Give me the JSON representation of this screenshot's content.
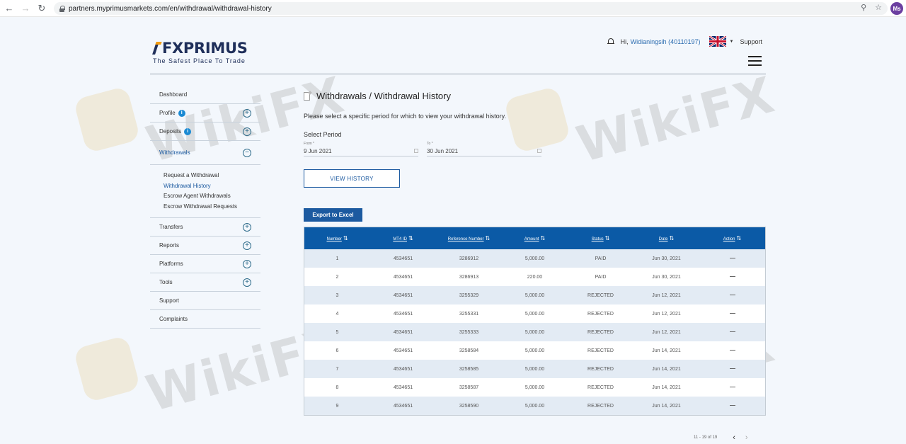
{
  "browser": {
    "back_icon": "arrow-left-icon",
    "forward_icon": "arrow-right-icon",
    "reload_icon": "reload-icon",
    "url": "partners.myprimusmarkets.com/en/withdrawal/withdrawal-history",
    "profile_initials": "Ms"
  },
  "header": {
    "logo_text": "FXPRIMUS",
    "tagline": "The Safest Place To Trade",
    "greeting": "Hi,",
    "user": "Widianingsih (40110197)",
    "support": "Support"
  },
  "sidebar": {
    "items": [
      {
        "label": "Dashboard"
      },
      {
        "label": "Profile"
      },
      {
        "label": "Deposits"
      },
      {
        "label": "Withdrawals"
      },
      {
        "label": "Transfers"
      },
      {
        "label": "Reports"
      },
      {
        "label": "Platforms"
      },
      {
        "label": "Tools"
      },
      {
        "label": "Support"
      },
      {
        "label": "Complaints"
      }
    ],
    "withdrawal_sub": [
      "Request a Withdrawal",
      "Withdrawal History",
      "Escrow Agent Withdrawals",
      "Escrow Withdrawal Requests"
    ]
  },
  "main": {
    "title": "Withdrawals / Withdrawal History",
    "intro": "Please select a specific period for which to view your withdrawal history.",
    "select_period": "Select Period",
    "from_label": "From *",
    "from_value": "9 Jun 2021",
    "to_label": "To *",
    "to_value": "30 Jun 2021",
    "view_history": "VIEW HISTORY",
    "export": "Export to Excel"
  },
  "table": {
    "columns": [
      "Number",
      "MT4 ID",
      "Reference Number",
      "Amount",
      "Status",
      "Date",
      "Action"
    ],
    "rows": [
      [
        "1",
        "4534651",
        "3286912",
        "5,000.00",
        "PAID",
        "Jun 30, 2021"
      ],
      [
        "2",
        "4534651",
        "3286913",
        "220.00",
        "PAID",
        "Jun 30, 2021"
      ],
      [
        "3",
        "4534651",
        "3255329",
        "5,000.00",
        "REJECTED",
        "Jun 12, 2021"
      ],
      [
        "4",
        "4534651",
        "3255331",
        "5,000.00",
        "REJECTED",
        "Jun 12, 2021"
      ],
      [
        "5",
        "4534651",
        "3255333",
        "5,000.00",
        "REJECTED",
        "Jun 12, 2021"
      ],
      [
        "6",
        "4534651",
        "3258584",
        "5,000.00",
        "REJECTED",
        "Jun 14, 2021"
      ],
      [
        "7",
        "4534651",
        "3258585",
        "5,000.00",
        "REJECTED",
        "Jun 14, 2021"
      ],
      [
        "8",
        "4534651",
        "3258587",
        "5,000.00",
        "REJECTED",
        "Jun 14, 2021"
      ],
      [
        "9",
        "4534651",
        "3258590",
        "5,000.00",
        "REJECTED",
        "Jun 14, 2021"
      ]
    ]
  },
  "pagination": {
    "range": "11 - 19 of 19",
    "prev_icon": "chevron-left-icon",
    "next_icon": "chevron-right-icon"
  },
  "watermark": "WikiFX",
  "colors": {
    "accent": "#1c5aa0",
    "table_header": "#0b5aa6",
    "row_alt": "#e3ebf4",
    "background": "#f3f7fc"
  }
}
